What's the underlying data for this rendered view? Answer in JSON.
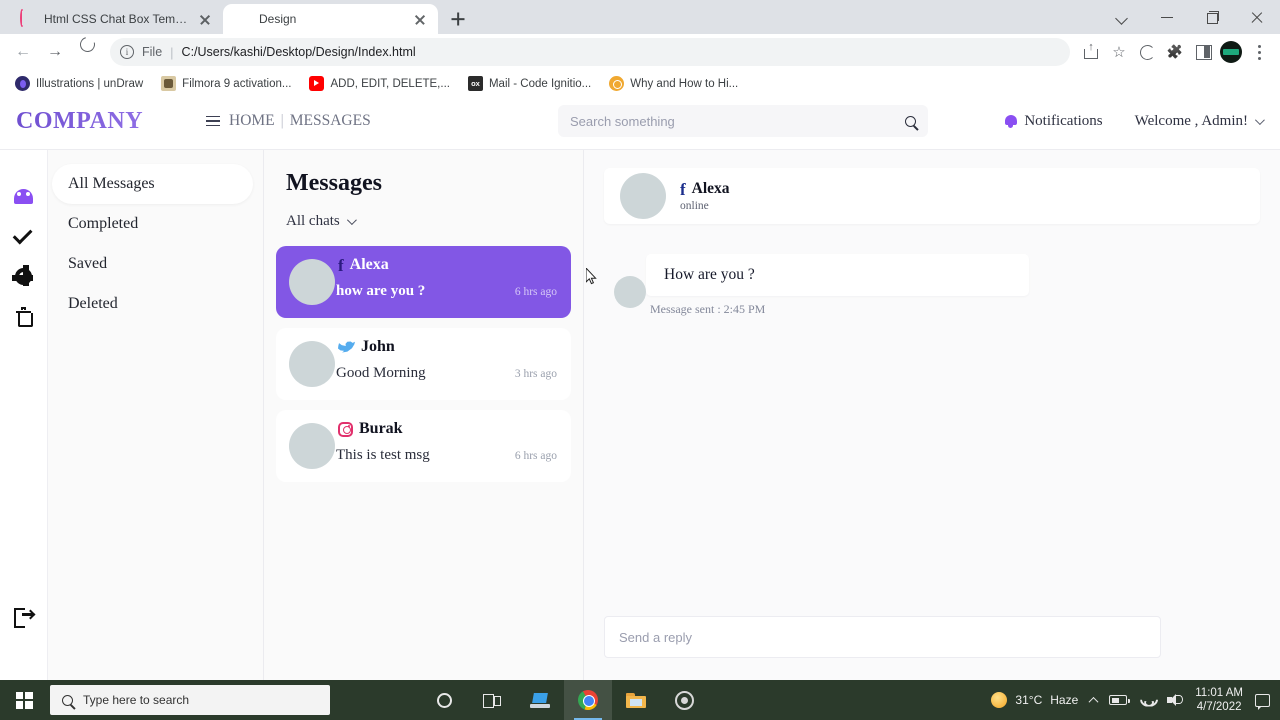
{
  "browser": {
    "tabs": [
      {
        "title": "Html CSS Chat Box Template Wit",
        "favicon": "c-circle-icon",
        "active": false
      },
      {
        "title": "Design",
        "favicon": "globe-icon",
        "active": true
      }
    ],
    "omnibox": {
      "scheme_label": "File",
      "url": "C:/Users/kashi/Desktop/Design/Index.html"
    },
    "bookmarks": [
      {
        "label": "Illustrations | unDraw"
      },
      {
        "label": "Filmora 9 activation..."
      },
      {
        "label": "ADD, EDIT, DELETE,..."
      },
      {
        "label": "Mail - Code Ignitio..."
      },
      {
        "label": "Why and How to Hi..."
      }
    ]
  },
  "app": {
    "logo": "COMPANY",
    "nav": {
      "home": "HOME",
      "separator": "|",
      "messages": "MESSAGES"
    },
    "search": {
      "placeholder": "Search something",
      "value": ""
    },
    "notifications_label": "Notifications",
    "welcome_label": "Welcome , Admin!",
    "accent_purple": "#8257e5",
    "logo_purple": "#7b5bd6"
  },
  "rail": {
    "items": [
      {
        "icon": "dashboard-gauge-icon"
      },
      {
        "icon": "check-icon"
      },
      {
        "icon": "gear-icon"
      },
      {
        "icon": "trash-icon"
      }
    ],
    "logout": {
      "icon": "logout-icon"
    }
  },
  "menu": {
    "items": [
      {
        "label": "All Messages",
        "active": true
      },
      {
        "label": "Completed",
        "active": false
      },
      {
        "label": "Saved",
        "active": false
      },
      {
        "label": "Deleted",
        "active": false
      }
    ]
  },
  "messages_panel": {
    "title": "Messages",
    "filter_label": "All chats",
    "chats": [
      {
        "name": "Alexa",
        "network": "facebook",
        "preview": "how are you ?",
        "time": "6 hrs ago",
        "active": true
      },
      {
        "name": "John",
        "network": "twitter",
        "preview": "Good Morning",
        "time": "3 hrs ago",
        "active": false
      },
      {
        "name": "Burak",
        "network": "instagram",
        "preview": "This is test msg",
        "time": "6 hrs ago",
        "active": false
      }
    ]
  },
  "conversation": {
    "header": {
      "name": "Alexa",
      "network": "facebook",
      "status": "online"
    },
    "messages": [
      {
        "text": "How are you ?",
        "meta": "Message sent : 2:45 PM"
      }
    ],
    "reply": {
      "placeholder": "Send a reply",
      "value": "",
      "send_icon": "paper-plane-icon"
    }
  },
  "taskbar": {
    "search_placeholder": "Type here to search",
    "weather": {
      "temp": "31°C",
      "condition": "Haze"
    },
    "clock": {
      "time": "11:01 AM",
      "date": "4/7/2022"
    }
  }
}
